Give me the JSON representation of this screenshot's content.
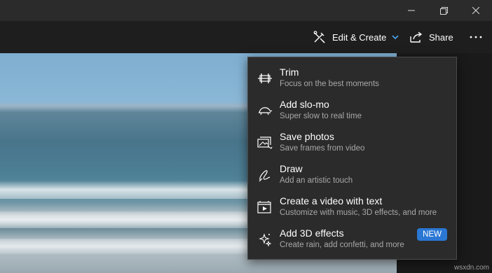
{
  "window": {
    "minimize_icon": "minimize-icon",
    "maximize_icon": "restore-icon",
    "close_icon": "close-icon"
  },
  "toolbar": {
    "edit_create_label": "Edit & Create",
    "share_label": "Share",
    "more_icon": "more-options-icon",
    "accent": "#4aa3f0"
  },
  "menu": {
    "items": [
      {
        "title": "Trim",
        "subtitle": "Focus on the best moments",
        "icon": "trim-icon"
      },
      {
        "title": "Add slo-mo",
        "subtitle": "Super slow to real time",
        "icon": "slo-mo-icon"
      },
      {
        "title": "Save photos",
        "subtitle": "Save frames from video",
        "icon": "save-photos-icon"
      },
      {
        "title": "Draw",
        "subtitle": "Add an artistic touch",
        "icon": "draw-icon"
      },
      {
        "title": "Create a video with text",
        "subtitle": "Customize with music, 3D effects, and more",
        "icon": "video-text-icon"
      },
      {
        "title": "Add 3D effects",
        "subtitle": "Create rain, add confetti, and more",
        "icon": "3d-effects-icon",
        "badge": "NEW"
      }
    ],
    "badge_color": "#2a77d4"
  },
  "watermark": "wsxdn.com"
}
